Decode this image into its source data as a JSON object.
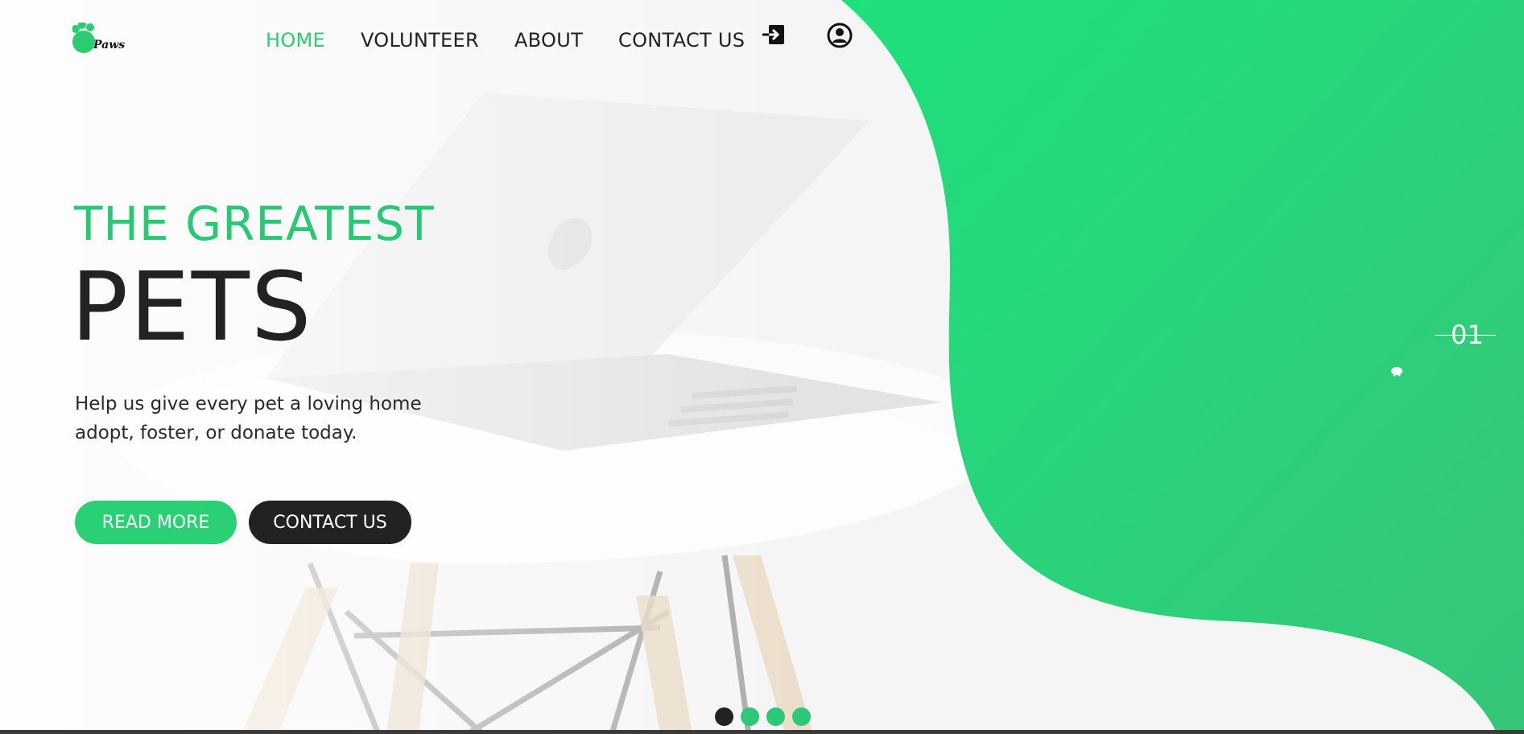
{
  "brand": {
    "logo_text": "Paws",
    "accent_color": "#2ecc71",
    "dark_color": "#222222"
  },
  "nav": {
    "items": [
      {
        "label": "HOME",
        "active": true
      },
      {
        "label": "VOLUNTEER",
        "active": false
      },
      {
        "label": "ABOUT",
        "active": false
      },
      {
        "label": "CONTACT US",
        "active": false
      }
    ],
    "icons": [
      "login-icon",
      "user-account-icon"
    ]
  },
  "hero": {
    "kicker": "THE GREATEST",
    "title": "PETS",
    "subtitle_lines": [
      "Help us give every pet a loving home",
      "adopt, foster, or donate today."
    ],
    "primary_button": "READ MORE",
    "secondary_button": "CONTACT US"
  },
  "slider": {
    "current": "01",
    "dot_count": 4,
    "active_dot": 0
  }
}
